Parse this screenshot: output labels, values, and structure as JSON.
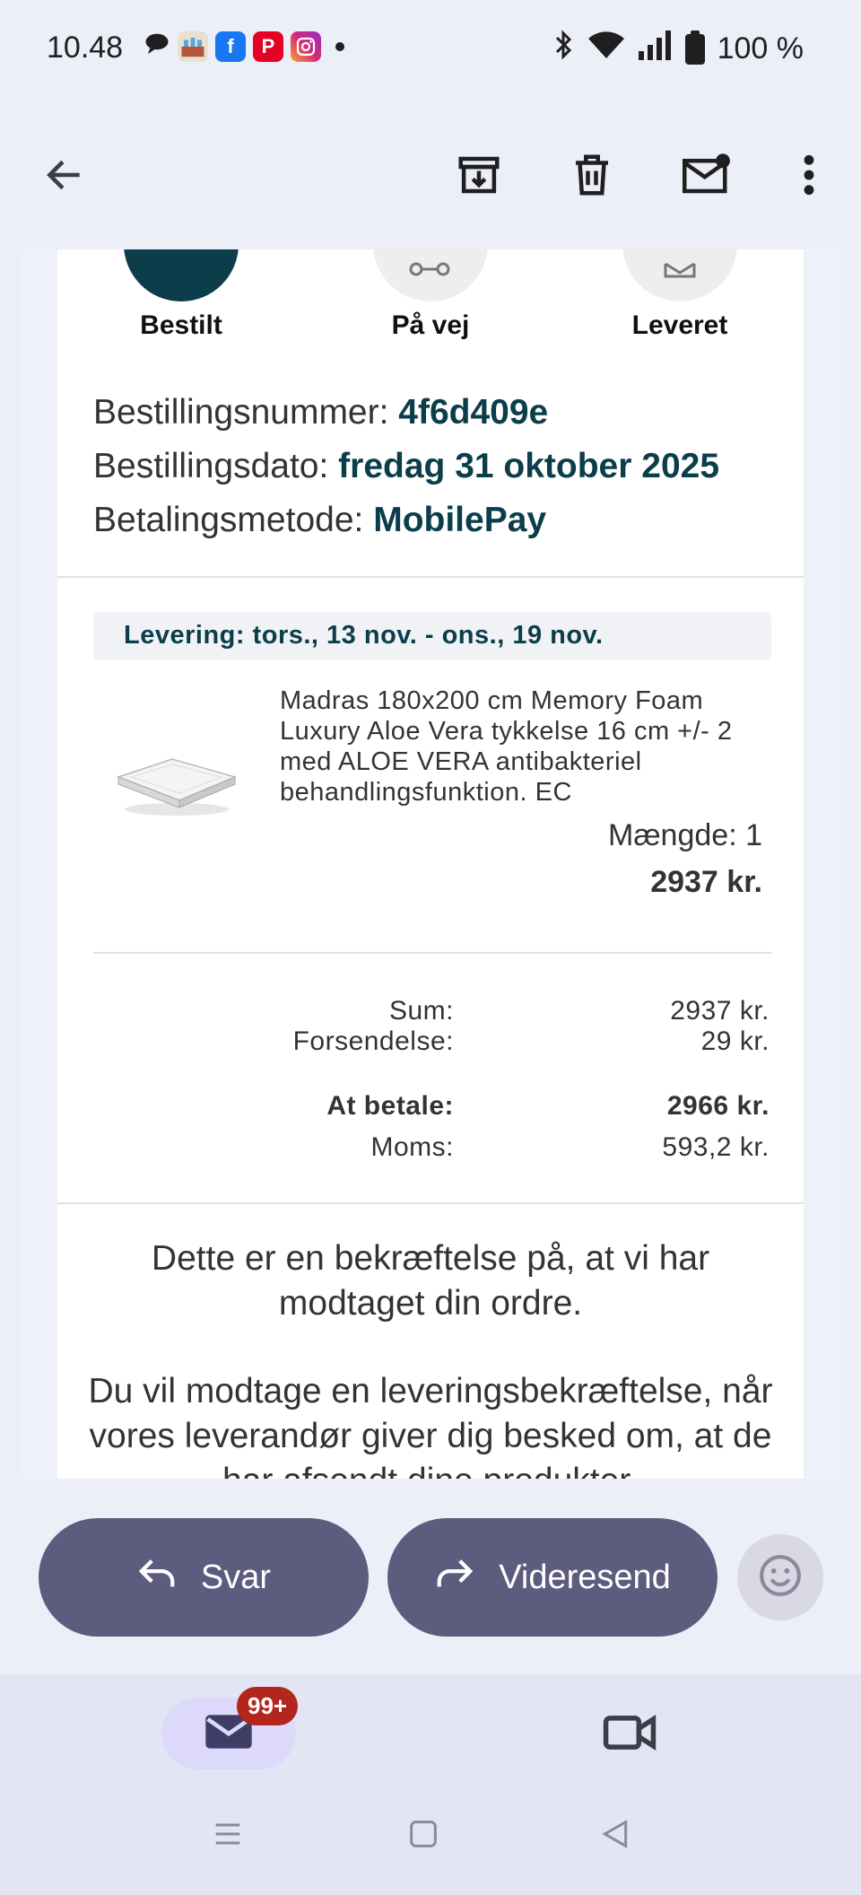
{
  "status_bar": {
    "time": "10.48",
    "battery_text": "100 %",
    "icons": [
      "chat-bubble-icon",
      "app-icon",
      "facebook-icon",
      "pinterest-icon",
      "instagram-icon",
      "dot-icon",
      "bluetooth-icon",
      "wifi-icon",
      "signal-icon",
      "battery-icon"
    ]
  },
  "toolbar": {
    "icons": [
      "back-arrow-icon",
      "archive-icon",
      "trash-icon",
      "mark-unread-icon",
      "more-vert-icon"
    ]
  },
  "email": {
    "steps": [
      {
        "label": "Bestilt"
      },
      {
        "label": "På vej"
      },
      {
        "label": "Leveret"
      }
    ],
    "order_info": {
      "number_label": "Bestillingsnummer:",
      "number_value": "4f6d409e",
      "date_label": "Bestillingsdato:",
      "date_value": "fredag 31 oktober 2025",
      "payment_label": "Betalingsmetode:",
      "payment_value": "MobilePay"
    },
    "delivery": "Levering: tors., 13 nov. - ons., 19 nov.",
    "product": {
      "description": "Madras 180x200 cm Memory Foam Luxury Aloe Vera tykkelse 16 cm +/- 2 med ALOE VERA antibakteriel behandlingsfunktion. EC",
      "quantity": "Mængde: 1",
      "price": "2937 kr."
    },
    "summary": {
      "sum_label": "Sum:",
      "sum_value": "2937 kr.",
      "shipping_label": "Forsendelse:",
      "shipping_value": "29 kr.",
      "total_label": "At betale:",
      "total_value": "2966 kr.",
      "vat_label": "Moms:",
      "vat_value": "593,2 kr."
    },
    "confirmation_1": "Dette er en bekræftelse på, at vi har modtaget din ordre.",
    "confirmation_2": "Du vil modtage en leveringsbekræftelse, når vores leverandør giver dig besked om, at de har afsendt dine produkter."
  },
  "reply_bar": {
    "reply_label": "Svar",
    "forward_label": "Videresend"
  },
  "bottom_nav": {
    "mail_badge": "99+"
  },
  "colors": {
    "accent_dark": "#0b3d4a",
    "pill": "#5d5b7e",
    "badge": "#b3261e"
  }
}
